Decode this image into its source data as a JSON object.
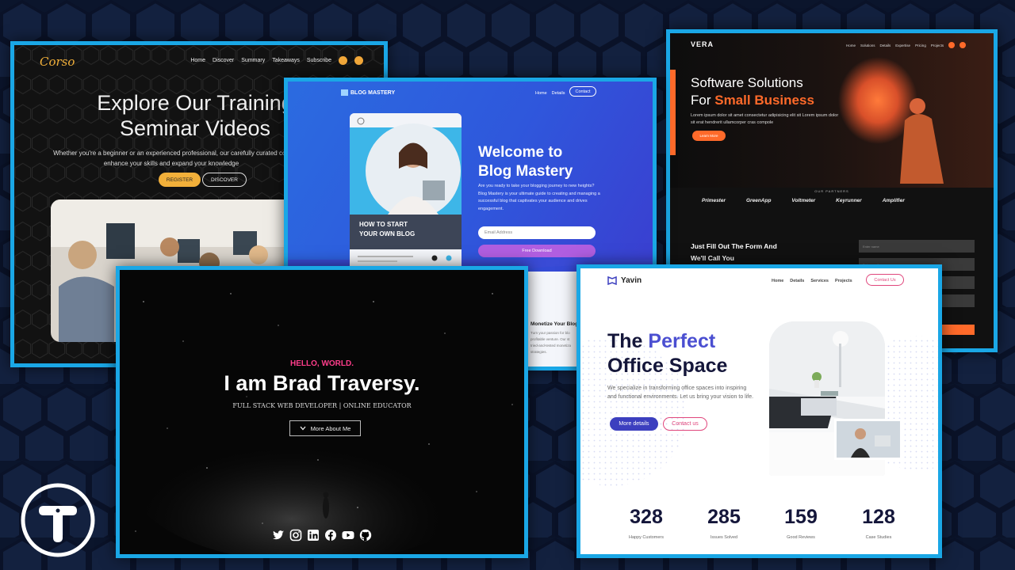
{
  "colors": {
    "background": "#0f1a33",
    "card_border": "#1aa7e6"
  },
  "corso": {
    "logo": "Corso",
    "nav": [
      "Home",
      "Discover",
      "Summary",
      "Takeaways",
      "Subscribe"
    ],
    "title_line1": "Explore Our Training",
    "title_line2": "Seminar Videos",
    "subtitle": "Whether you're a beginner or an experienced professional, our carefully curated con",
    "subtitle2": "enhance your skills and expand your knowledge",
    "register": "REGISTER",
    "discover": "DISCOVER",
    "accent": "#f2b03a"
  },
  "blog": {
    "logo": "BLOG MASTERY",
    "nav": [
      "Home",
      "Details"
    ],
    "contact": "Contact",
    "card_line1": "HOW TO START",
    "card_line2": "YOUR OWN BLOG",
    "title_line1": "Welcome to",
    "title_line2": "Blog Mastery",
    "desc": "Are you ready to take your blogging journey to new heights? Blog Mastery is your ultimate guide to creating and managing a successful blog that captivates your audience and drives engagement.",
    "email_placeholder": "Email Address",
    "download": "Free Download",
    "monetize_title": "Monetize Your Blog",
    "monetize_text": "Turn your passion for blo profitable venture. Our st tried-and-tested monetiza strategies."
  },
  "vera": {
    "logo": "VERA",
    "nav": [
      "Home",
      "Solutions",
      "Details",
      "Expertise",
      "Pricing",
      "Projects"
    ],
    "title_line1": "Software Solutions",
    "title_prefix": "For ",
    "title_highlight": "Small Business",
    "desc": "Lorem ipsum dolor sit amet consectetur adipisicing elit sit Lorem ipsum dolor sit erat hendrerit ullamcorper cras compole",
    "learn_more": "Learn More",
    "partners_title": "OUR PARTNERS",
    "partners": [
      "Primester",
      "GreenApp",
      "Voltmeter",
      "Keyrunner",
      "Amplifier"
    ],
    "form_title": "Just Fill Out The Form And We'll Call You",
    "inputs": [
      "Enter name",
      "Enter email",
      "",
      ""
    ],
    "accent": "#ff6a2a"
  },
  "brad": {
    "hello": "HELLO, WORLD.",
    "name": "I am Brad Traversy.",
    "role": "FULL STACK WEB DEVELOPER | ONLINE EDUCATOR",
    "more": "More About Me",
    "socials": [
      "twitter-icon",
      "instagram-icon",
      "linkedin-icon",
      "facebook-icon",
      "youtube-icon",
      "github-icon"
    ],
    "accent": "#ff3d8b"
  },
  "yavin": {
    "logo": "Yavin",
    "nav": [
      "Home",
      "Details",
      "Services",
      "Projects"
    ],
    "contact": "Contact Us",
    "title_prefix": "The ",
    "title_highlight": "Perfect",
    "title_line2": "Office Space",
    "desc": "We specialize in transforming office spaces into inspiring and functional environments. Let us bring your vision to life.",
    "more_details": "More details",
    "contact_us": "Contact us",
    "stats": [
      {
        "value": "328",
        "label": "Happy Customers"
      },
      {
        "value": "285",
        "label": "Issues Solved"
      },
      {
        "value": "159",
        "label": "Good Reviews"
      },
      {
        "value": "128",
        "label": "Case Studies"
      }
    ],
    "accent": "#4b4fd1"
  }
}
